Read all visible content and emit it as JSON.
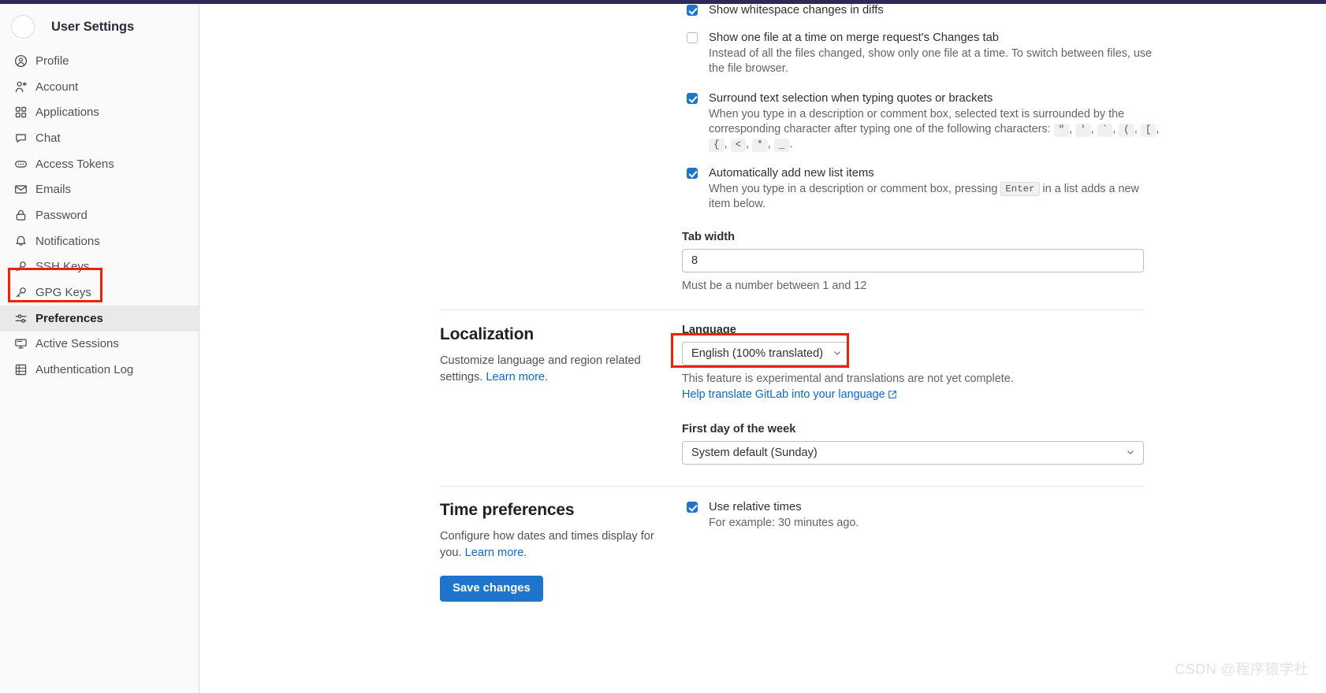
{
  "sidebar": {
    "title": "User Settings",
    "avatar_name": "user-avatar",
    "items": [
      {
        "label": "Profile",
        "icon": "user-circle-icon",
        "active": false
      },
      {
        "label": "Account",
        "icon": "account-icon",
        "active": false
      },
      {
        "label": "Applications",
        "icon": "applications-icon",
        "active": false
      },
      {
        "label": "Chat",
        "icon": "chat-icon",
        "active": false
      },
      {
        "label": "Access Tokens",
        "icon": "token-icon",
        "active": false
      },
      {
        "label": "Emails",
        "icon": "envelope-icon",
        "active": false
      },
      {
        "label": "Password",
        "icon": "lock-icon",
        "active": false
      },
      {
        "label": "Notifications",
        "icon": "bell-icon",
        "active": false
      },
      {
        "label": "SSH Keys",
        "icon": "key-icon",
        "active": false
      },
      {
        "label": "GPG Keys",
        "icon": "key-icon",
        "active": false
      },
      {
        "label": "Preferences",
        "icon": "sliders-icon",
        "active": true
      },
      {
        "label": "Active Sessions",
        "icon": "monitor-icon",
        "active": false
      },
      {
        "label": "Authentication Log",
        "icon": "log-icon",
        "active": false
      }
    ]
  },
  "behavior": {
    "whitespace": {
      "label": "Show whitespace changes in diffs",
      "checked": true
    },
    "one_file": {
      "label": "Show one file at a time on merge request's Changes tab",
      "help": "Instead of all the files changed, show only one file at a time. To switch between files, use the file browser.",
      "checked": false
    },
    "surround": {
      "label": "Surround text selection when typing quotes or brackets",
      "help_prefix": "When you type in a description or comment box, selected text is surrounded by the corresponding character after typing one of the following characters:",
      "characters": [
        "\"",
        "'",
        "`",
        "(",
        "[",
        "{",
        "<",
        "*",
        "_"
      ],
      "checked": true
    },
    "auto_list": {
      "label": "Automatically add new list items",
      "help_prefix": "When you type in a description or comment box, pressing",
      "help_key": "Enter",
      "help_suffix": "in a list adds a new item below.",
      "checked": true
    },
    "tab_width": {
      "label": "Tab width",
      "value": "8",
      "help": "Must be a number between 1 and 12"
    }
  },
  "localization": {
    "title": "Localization",
    "desc_prefix": "Customize language and region related settings.",
    "desc_link": "Learn more",
    "language": {
      "label": "Language",
      "value": "English (100% translated)",
      "help": "This feature is experimental and translations are not yet complete.",
      "translate_link": "Help translate GitLab into your language"
    },
    "first_day": {
      "label": "First day of the week",
      "value": "System default (Sunday)"
    }
  },
  "time_preferences": {
    "title": "Time preferences",
    "desc_prefix": "Configure how dates and times display for you.",
    "desc_link": "Learn more",
    "relative_times": {
      "label": "Use relative times",
      "help": "For example: 30 minutes ago.",
      "checked": true
    }
  },
  "actions": {
    "save_label": "Save changes"
  },
  "watermark": "CSDN @程序猿学社",
  "colors": {
    "accent": "#1f75cb",
    "link": "#1068bf",
    "highlight_box": "#ee2200",
    "sidebar_bg": "#fafafa",
    "top_strip": "#2b2b54"
  }
}
